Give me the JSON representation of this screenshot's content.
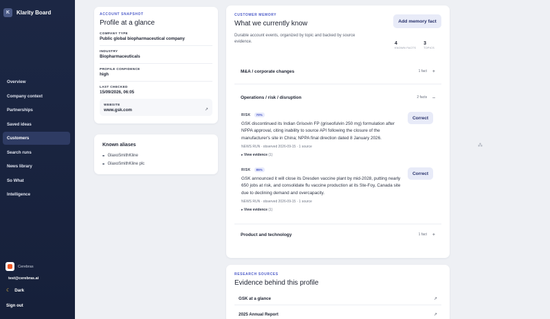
{
  "app": {
    "name": "Klarity Board",
    "logo_letter": "K"
  },
  "sidebar": {
    "items": [
      {
        "label": "Overview",
        "active": false
      },
      {
        "label": "Company context",
        "active": false
      },
      {
        "label": "Partnerships",
        "active": false
      },
      {
        "label": "Saved ideas",
        "active": false
      },
      {
        "label": "Customers",
        "active": true
      },
      {
        "label": "Search runs",
        "active": false
      },
      {
        "label": "News library",
        "active": false
      },
      {
        "label": "So What",
        "active": false
      },
      {
        "label": "Intelligence",
        "active": false
      }
    ],
    "org_name": "Cerebras",
    "email": "test@cerebras.ai",
    "theme_label": "Dark",
    "signout_label": "Sign out"
  },
  "snapshot": {
    "eyebrow": "ACCOUNT SNAPSHOT",
    "title": "Profile at a glance",
    "fields": [
      {
        "label": "COMPANY TYPE",
        "value": "Public global biopharmaceutical company"
      },
      {
        "label": "INDUSTRY",
        "value": "Biopharmaceuticals"
      },
      {
        "label": "PROFILE CONFIDENCE",
        "value": "high"
      },
      {
        "label": "LAST CHECKED",
        "value": "15/09/2026, 06:05"
      }
    ],
    "website_label": "WEBSITE",
    "website_value": "www.gsk.com"
  },
  "aliases": {
    "title": "Known aliases",
    "items": [
      "GlaxoSmithKline",
      "GlaxoSmithKline plc"
    ]
  },
  "memory": {
    "eyebrow": "CUSTOMER MEMORY",
    "title": "What we currently know",
    "description": "Durable account events, organized by topic and backed by source evidence.",
    "add_label": "Add memory fact",
    "known_facts": "4",
    "known_facts_label": "KNOWN FACTS",
    "topics": "3",
    "topics_label": "TOPICS",
    "sections": [
      {
        "title": "M&A / corporate changes",
        "count": "1 fact",
        "toggle": "+"
      },
      {
        "title": "Operations / risk / disruption",
        "count": "2 facts",
        "toggle": "–"
      },
      {
        "title": "Product and technology",
        "count": "1 fact",
        "toggle": "+"
      }
    ],
    "facts": [
      {
        "tag": "RISK",
        "confidence": "70%",
        "text": "GSK discontinued its Indian Grisovin FP (griseofulvin 250 mg) formulation after NPPA approval, citing inability to source API following the closure of the manufacturer's site in China; NPPA final direction dated 8 January 2026.",
        "meta": "NEWS RUN · observed 2026-09-15 · 1 source",
        "evidence_label": "▸ View evidence",
        "evidence_count": "(1)",
        "correct_label": "Correct"
      },
      {
        "tag": "RISK",
        "confidence": "85%",
        "text": "GSK announced it will close its Dresden vaccine plant by mid-2028, putting nearly 650 jobs at risk, and consolidate flu vaccine production at its Ste-Foy, Canada site due to declining demand and overcapacity.",
        "meta": "NEWS RUN · observed 2026-09-15 · 1 source",
        "evidence_label": "▸ View evidence",
        "evidence_count": "(1)",
        "correct_label": "Correct"
      }
    ]
  },
  "sources": {
    "eyebrow": "RESEARCH SOURCES",
    "title": "Evidence behind this profile",
    "items": [
      "GSK at a glance",
      "2025 Annual Report"
    ]
  },
  "icons": {
    "external_link": "↗",
    "moon": "☾",
    "cursor": "⁂"
  }
}
